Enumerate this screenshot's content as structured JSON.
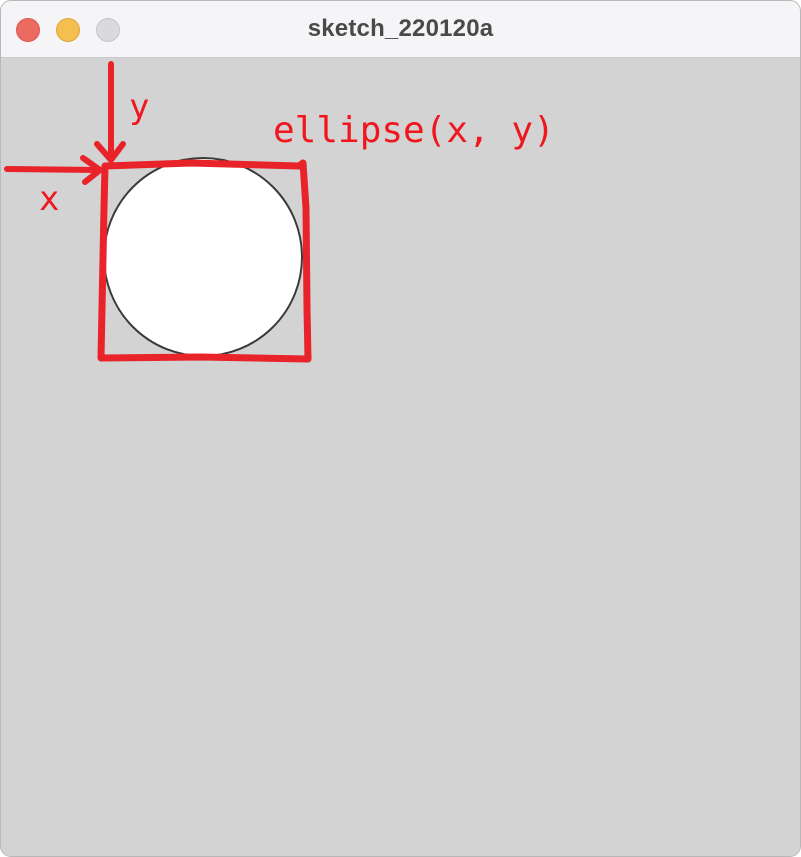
{
  "window": {
    "title": "sketch_220120a",
    "controls": {
      "close": "close-button",
      "minimize": "minimize-button",
      "zoom": "zoom-button"
    }
  },
  "canvas": {
    "background": "#d3d3d3",
    "shape": {
      "type": "ellipse",
      "fill": "#ffffff",
      "stroke": "#3a3a3a"
    },
    "annotations": {
      "color": "#e8232a",
      "code_label": "ellipse(x, y)",
      "x_label": "x",
      "y_label": "y"
    }
  }
}
